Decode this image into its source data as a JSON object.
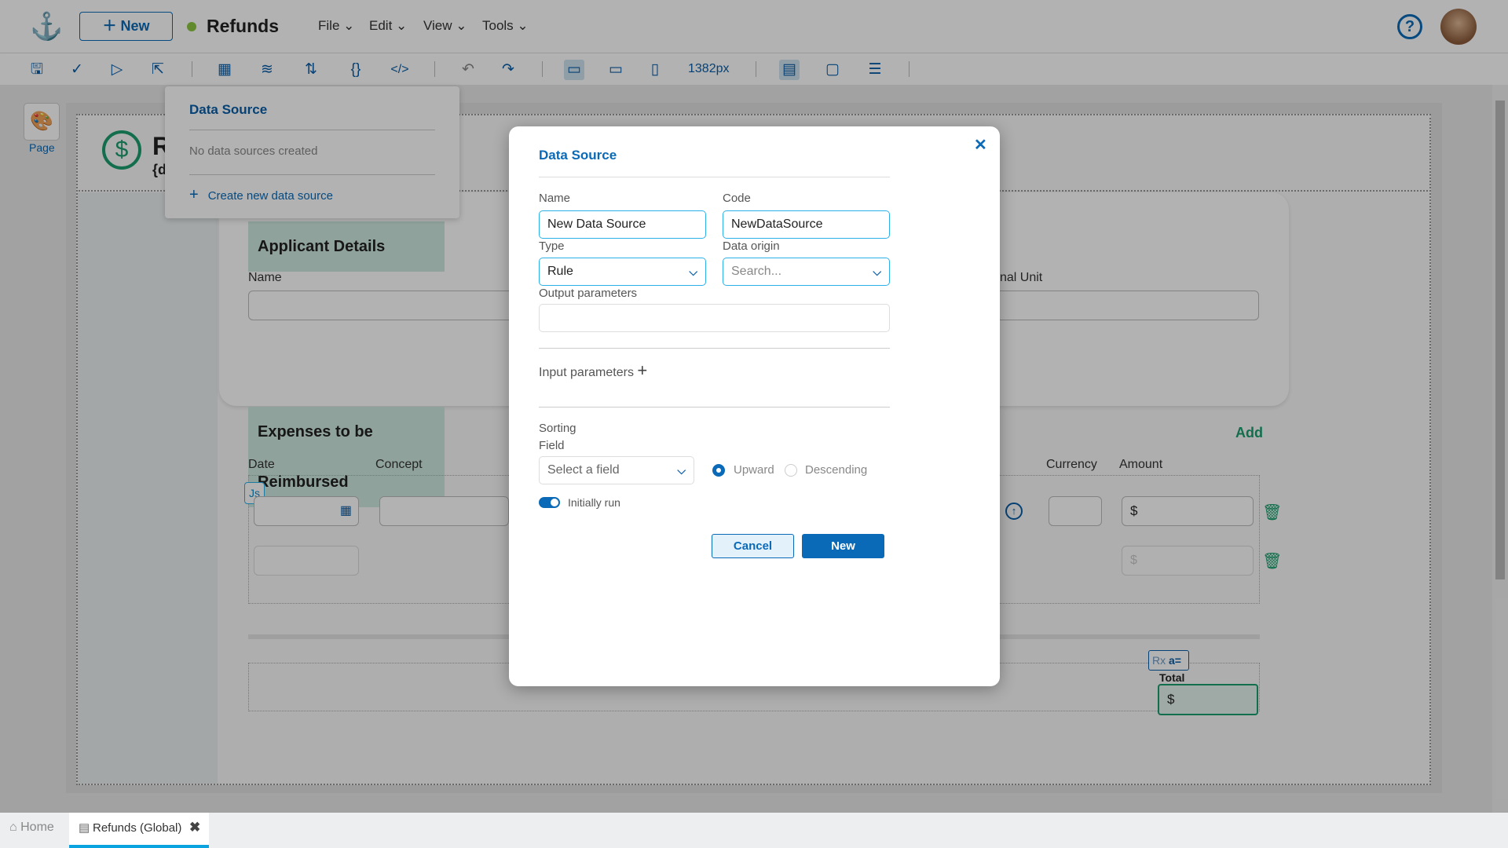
{
  "header": {
    "new_label": "New",
    "app_title": "Refunds",
    "status_color": "#8cc63f",
    "menus": [
      "File",
      "Edit",
      "View",
      "Tools"
    ]
  },
  "toolbar": {
    "width_readout": "1382px"
  },
  "left_panel": {
    "page_label": "Page"
  },
  "canvas": {
    "title_initial": "R",
    "title_sub": "{d",
    "applicant_section": "Applicant Details",
    "name_label": "Name",
    "org_unit_label": "nal Unit",
    "expenses_section": "Expenses to be Reimbursed",
    "add_label": "Add",
    "columns": [
      "Date",
      "Concept",
      "Currency",
      "Amount"
    ],
    "currency_symbol": "$",
    "js_badge": "Js",
    "rx_badge": "Rx",
    "total_label": "Total"
  },
  "popover": {
    "title": "Data Source",
    "empty_text": "No data sources created",
    "create_label": "Create new data source"
  },
  "modal": {
    "title": "Data Source",
    "name_label": "Name",
    "name_value": "New Data Source",
    "code_label": "Code",
    "code_value": "NewDataSource",
    "type_label": "Type",
    "type_value": "Rule",
    "origin_label": "Data origin",
    "origin_placeholder": "Search...",
    "output_label": "Output parameters",
    "input_label": "Input parameters",
    "sorting_label": "Sorting",
    "field_label": "Field",
    "field_placeholder": "Select a field",
    "upward_label": "Upward",
    "descending_label": "Descending",
    "sort_selected": "Upward",
    "initially_run_label": "Initially run",
    "initially_run": true,
    "cancel_label": "Cancel",
    "new_label": "New"
  },
  "tabs": [
    {
      "label": "Home",
      "active": false
    },
    {
      "label": "Refunds (Global)",
      "active": true
    }
  ],
  "colors": {
    "primary": "#0a6ab8",
    "accent_green": "#1a9e6e",
    "input_border": "#2bb0e8"
  }
}
